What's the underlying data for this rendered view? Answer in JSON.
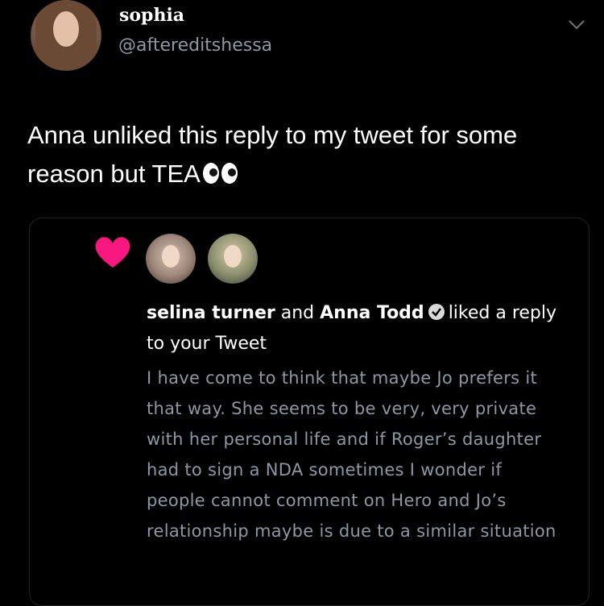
{
  "author": {
    "display_name": "sophia",
    "handle": "@aftereditshessa"
  },
  "icons": {
    "menu": "chevron-down-icon",
    "like": "heart-icon",
    "verified": "verified-badge-icon",
    "emoji": "eyes-emoji-icon"
  },
  "colors": {
    "background": "#000000",
    "heart": "#f91880",
    "verified": "#d9d9d9",
    "muted_text": "#8b98a5"
  },
  "tweet": {
    "text": "Anna unliked this reply to my tweet for some reason but TEA"
  },
  "notification": {
    "user1": "selina turner",
    "conjunction": "and",
    "user2": "Anna Todd",
    "action": "liked a reply to your Tweet",
    "reply_text": "I have come to think that maybe Jo prefers it that way. She seems to be very, very private with her personal life and if Roger’s daughter had to sign a NDA sometimes I wonder if people cannot comment on Hero and Jo’s relationship maybe is due to a similar situation"
  }
}
